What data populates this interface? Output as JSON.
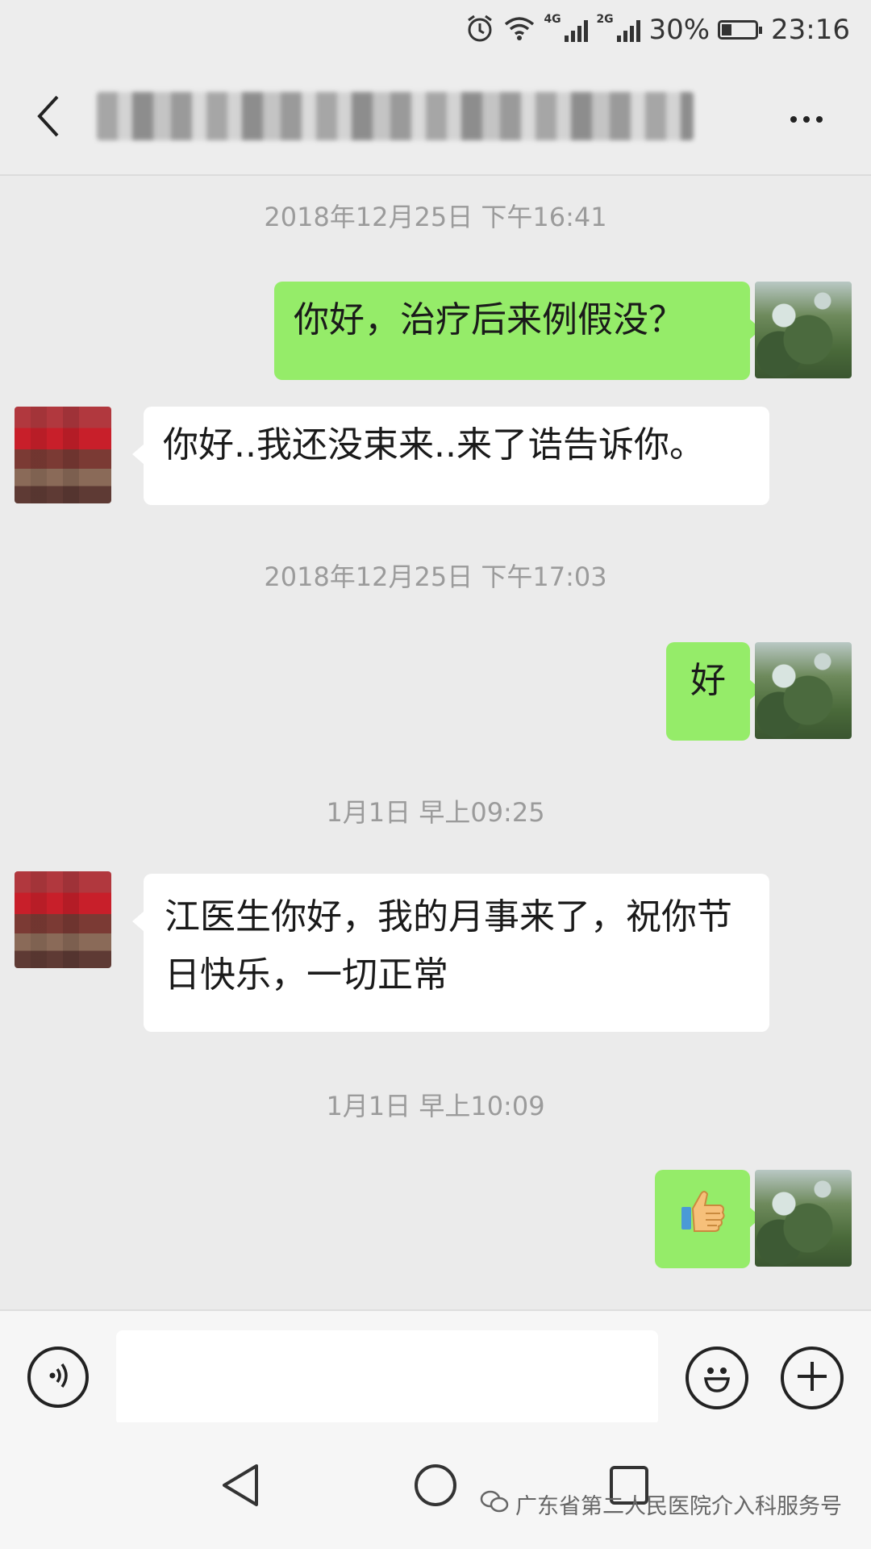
{
  "status_bar": {
    "network_1": "4G",
    "network_2": "2G",
    "battery_percent": "30%",
    "battery_level": 0.3,
    "time": "23:16",
    "icons": [
      "alarm-icon",
      "wifi-icon",
      "signal-icon",
      "battery-icon"
    ]
  },
  "header": {
    "back_icon": "chevron-left-icon",
    "title": "",
    "more_icon": "more-dots-icon"
  },
  "messages": [
    {
      "type": "timestamp",
      "text": "2018年12月25日 下午16:41"
    },
    {
      "type": "message",
      "from": "me",
      "text": "你好，治疗后来例假没？"
    },
    {
      "type": "message",
      "from": "other",
      "text": "你好..我还没束来..来了诰告诉你。"
    },
    {
      "type": "timestamp",
      "text": "2018年12月25日 下午17:03"
    },
    {
      "type": "message",
      "from": "me",
      "text": "好"
    },
    {
      "type": "timestamp",
      "text": "1月1日 早上09:25"
    },
    {
      "type": "message",
      "from": "other",
      "text": "江医生你好，我的月事来了，祝你节日快乐，一切正常"
    },
    {
      "type": "timestamp",
      "text": "1月1日 早上10:09"
    },
    {
      "type": "message",
      "from": "me",
      "sticker": "thumbs-up-icon"
    }
  ],
  "input_bar": {
    "voice_icon": "voice-icon",
    "placeholder": "",
    "emoji_icon": "emoji-icon",
    "plus_icon": "plus-icon"
  },
  "nav_bar": {
    "back_icon": "nav-back-icon",
    "home_icon": "nav-home-icon",
    "recents_icon": "nav-recents-icon"
  },
  "watermark": {
    "text": "广东省第二人民医院介入科服务号"
  },
  "colors": {
    "sent_bubble": "#95ec69",
    "received_bubble": "#ffffff",
    "chat_background": "#ebebeb"
  }
}
